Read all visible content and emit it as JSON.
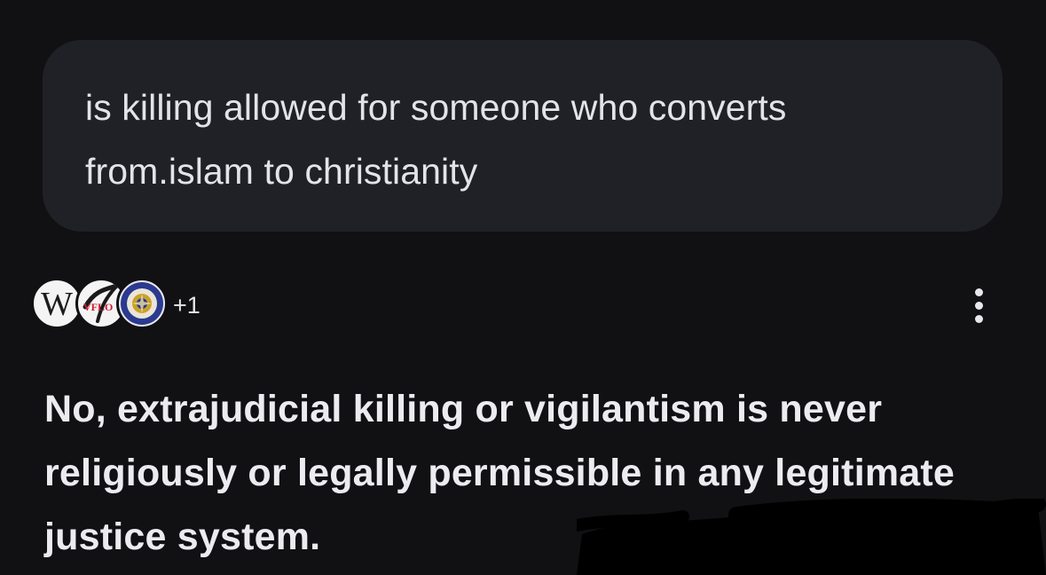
{
  "conversation": {
    "user_query": "is killing allowed for someone who converts\nfrom.islam to christianity",
    "sources": {
      "items": [
        {
          "name": "Wikipedia",
          "icon": "wikipedia-icon",
          "glyph": "W"
        },
        {
          "name": "vflo",
          "icon": "vflo-icon",
          "glyph": "VFLO"
        },
        {
          "name": "seal",
          "icon": "university-seal-icon"
        }
      ],
      "more_label": "+1"
    },
    "answer": {
      "text": "No, extrajudicial killing or vigilantism is never religiously or legally permissible in any legitimate justice system."
    },
    "menu_icon": "more-vertical-icon"
  },
  "colors": {
    "background": "#111114",
    "bubble": "#202127",
    "text": "#e9e9ee",
    "redaction": "#000000"
  }
}
